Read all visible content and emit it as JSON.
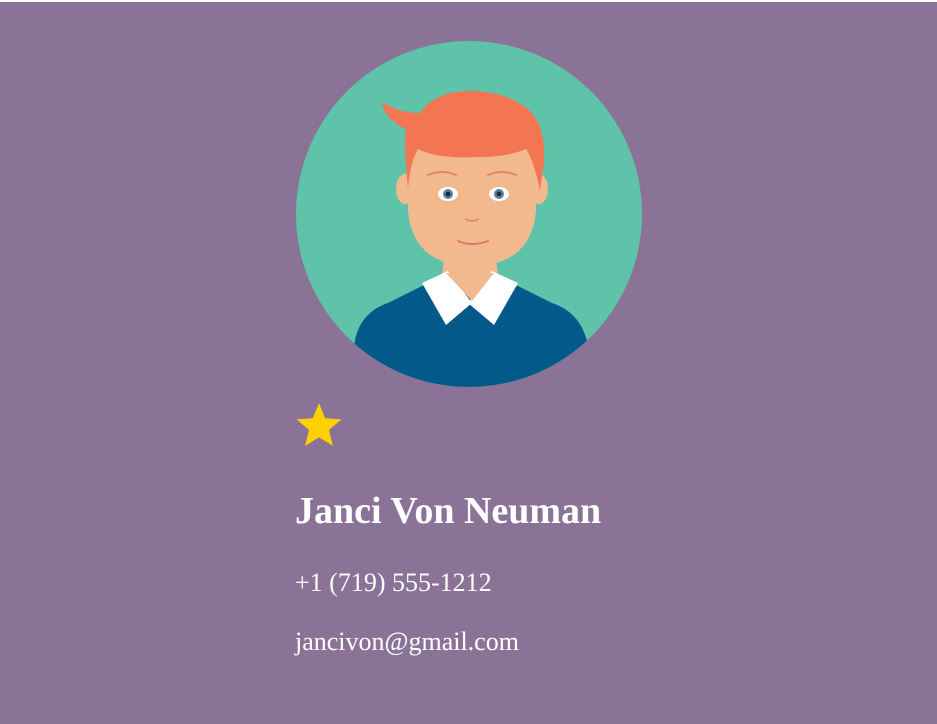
{
  "profile": {
    "name": "Janci Von Neuman",
    "phone": "+1 (719) 555-1212",
    "email": "jancivon@gmail.com",
    "avatar_icon": "boy-avatar-icon",
    "favorite_icon": "star-icon"
  },
  "colors": {
    "background": "#8a7397",
    "avatar_circle": "#5fc3a9",
    "hair": "#f47551",
    "skin": "#f3b98e",
    "sweater": "#035a8a",
    "collar": "#ffffff",
    "star": "#ffd000",
    "text": "#ffffff"
  }
}
